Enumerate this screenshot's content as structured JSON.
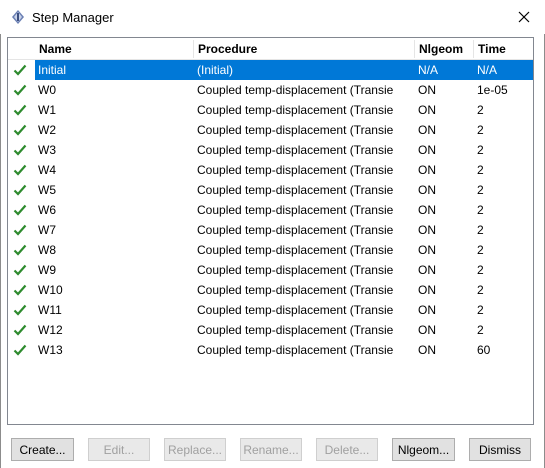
{
  "window": {
    "title": "Step Manager"
  },
  "table": {
    "columns": [
      "Name",
      "Procedure",
      "Nlgeom",
      "Time"
    ],
    "rows": [
      {
        "name": "Initial",
        "procedure": "(Initial)",
        "nlgeom": "N/A",
        "time": "N/A",
        "selected": true
      },
      {
        "name": "W0",
        "procedure": "Coupled temp-displacement (Transie",
        "nlgeom": "ON",
        "time": "1e-05"
      },
      {
        "name": "W1",
        "procedure": "Coupled temp-displacement (Transie",
        "nlgeom": "ON",
        "time": "2"
      },
      {
        "name": "W2",
        "procedure": "Coupled temp-displacement (Transie",
        "nlgeom": "ON",
        "time": "2"
      },
      {
        "name": "W3",
        "procedure": "Coupled temp-displacement (Transie",
        "nlgeom": "ON",
        "time": "2"
      },
      {
        "name": "W4",
        "procedure": "Coupled temp-displacement (Transie",
        "nlgeom": "ON",
        "time": "2"
      },
      {
        "name": "W5",
        "procedure": "Coupled temp-displacement (Transie",
        "nlgeom": "ON",
        "time": "2"
      },
      {
        "name": "W6",
        "procedure": "Coupled temp-displacement (Transie",
        "nlgeom": "ON",
        "time": "2"
      },
      {
        "name": "W7",
        "procedure": "Coupled temp-displacement (Transie",
        "nlgeom": "ON",
        "time": "2"
      },
      {
        "name": "W8",
        "procedure": "Coupled temp-displacement (Transie",
        "nlgeom": "ON",
        "time": "2"
      },
      {
        "name": "W9",
        "procedure": "Coupled temp-displacement (Transie",
        "nlgeom": "ON",
        "time": "2"
      },
      {
        "name": "W10",
        "procedure": "Coupled temp-displacement (Transie",
        "nlgeom": "ON",
        "time": "2"
      },
      {
        "name": "W11",
        "procedure": "Coupled temp-displacement (Transie",
        "nlgeom": "ON",
        "time": "2"
      },
      {
        "name": "W12",
        "procedure": "Coupled temp-displacement (Transie",
        "nlgeom": "ON",
        "time": "2"
      },
      {
        "name": "W13",
        "procedure": "Coupled temp-displacement (Transie",
        "nlgeom": "ON",
        "time": "60"
      }
    ]
  },
  "buttons": {
    "create": "Create...",
    "edit": "Edit...",
    "replace": "Replace...",
    "rename": "Rename...",
    "delete": "Delete...",
    "nlgeom": "Nlgeom...",
    "dismiss": "Dismiss"
  },
  "icons": {
    "check": "check-icon",
    "close": "close-icon",
    "app": "step-manager-icon"
  },
  "colors": {
    "selection": "#0078d7",
    "check": "#2e8b2e"
  }
}
